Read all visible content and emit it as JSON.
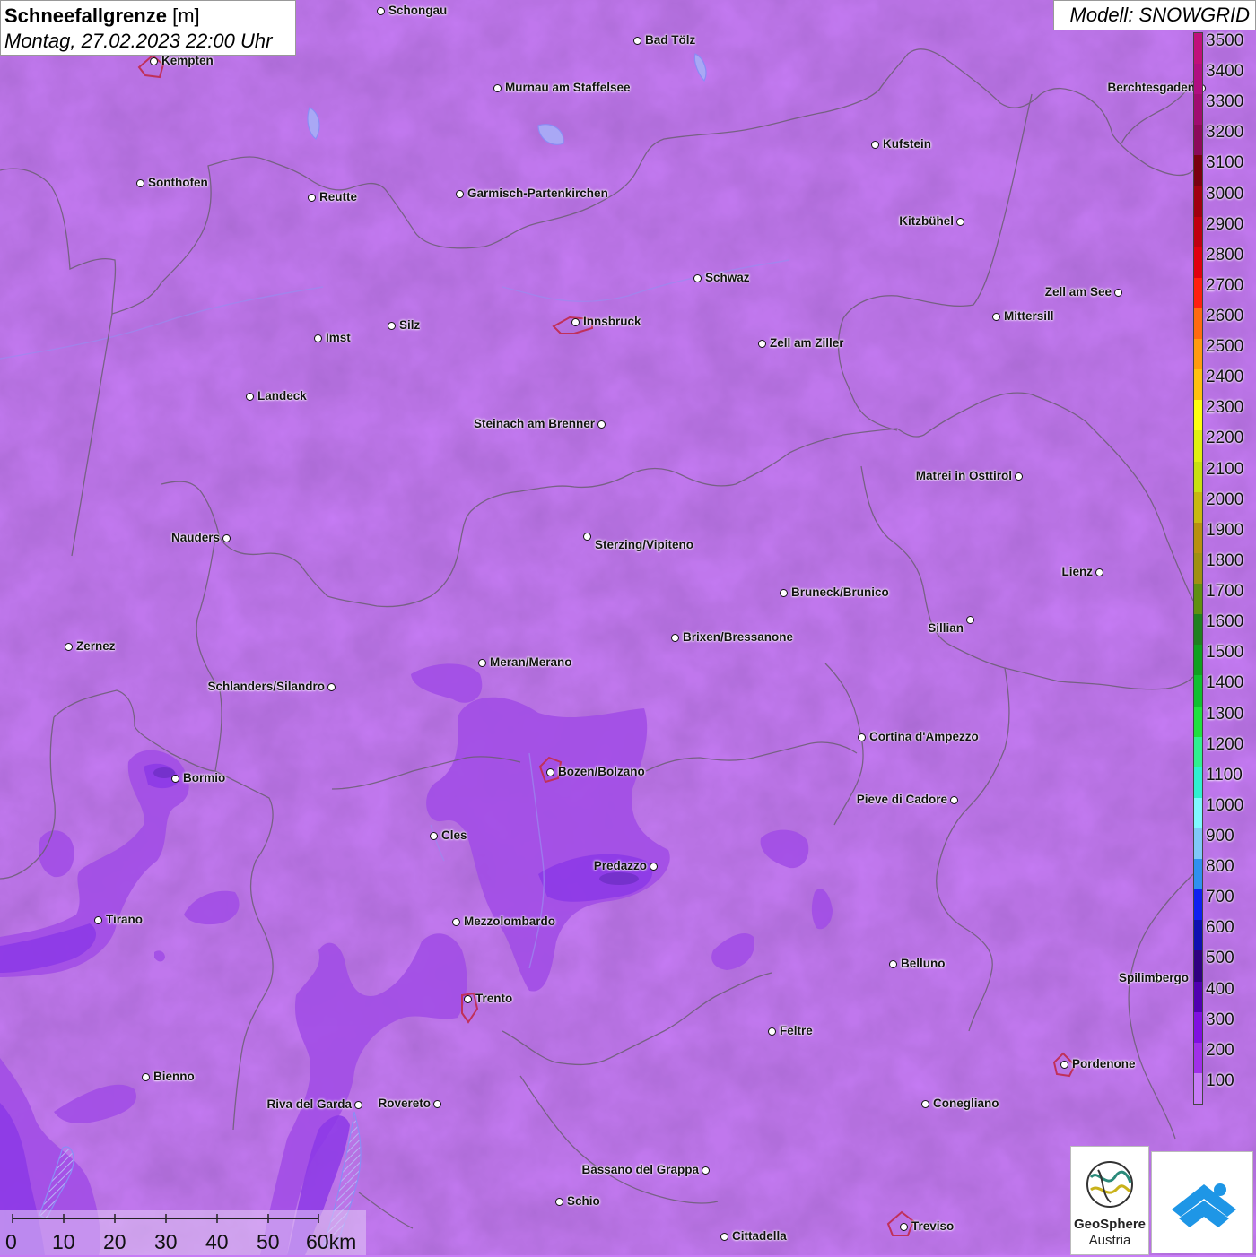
{
  "title": {
    "parameter": "Schneefallgrenze",
    "unit": "[m]",
    "datetime": "Montag, 27.02.2023 22:00 Uhr"
  },
  "model": "Modell: SNOWGRID",
  "colors": {
    "base_field": "#c77cf6",
    "field_200": "#a24ee6",
    "field_300": "#8c38e6",
    "field_400": "#7a2fd6",
    "borders": "#6b5e73",
    "lakes": "#8a8cf5",
    "city_outline": "#c0305a"
  },
  "cities": [
    {
      "name": "Schongau"
    },
    {
      "name": "Kempten"
    },
    {
      "name": "Bad Tölz"
    },
    {
      "name": "Murnau am Staffelsee"
    },
    {
      "name": "Berchtesgaden"
    },
    {
      "name": "Kufstein"
    },
    {
      "name": "Sonthofen"
    },
    {
      "name": "Reutte"
    },
    {
      "name": "Garmisch-Partenkirchen"
    },
    {
      "name": "Kitzbühel"
    },
    {
      "name": "Schwaz"
    },
    {
      "name": "Zell am See"
    },
    {
      "name": "Innsbruck"
    },
    {
      "name": "Mittersill"
    },
    {
      "name": "Imst"
    },
    {
      "name": "Silz"
    },
    {
      "name": "Zell am Ziller"
    },
    {
      "name": "Landeck"
    },
    {
      "name": "Steinach am Brenner"
    },
    {
      "name": "Matrei in Osttirol"
    },
    {
      "name": "Nauders"
    },
    {
      "name": "Sterzing/Vipiteno"
    },
    {
      "name": "Lienz"
    },
    {
      "name": "Bruneck/Brunico"
    },
    {
      "name": "Sillian"
    },
    {
      "name": "Zernez"
    },
    {
      "name": "Brixen/Bressanone"
    },
    {
      "name": "Meran/Merano"
    },
    {
      "name": "Schlanders/Silandro"
    },
    {
      "name": "Cortina d'Ampezzo"
    },
    {
      "name": "Bozen/Bolzano"
    },
    {
      "name": "Bormio"
    },
    {
      "name": "Pieve di Cadore"
    },
    {
      "name": "Cles"
    },
    {
      "name": "Predazzo"
    },
    {
      "name": "Tirano"
    },
    {
      "name": "Mezzolombardo"
    },
    {
      "name": "Belluno"
    },
    {
      "name": "Spilimbergo"
    },
    {
      "name": "Trento"
    },
    {
      "name": "Feltre"
    },
    {
      "name": "Pordenone"
    },
    {
      "name": "Bienno"
    },
    {
      "name": "Riva del Garda"
    },
    {
      "name": "Rovereto"
    },
    {
      "name": "Conegliano"
    },
    {
      "name": "Bassano del Grappa"
    },
    {
      "name": "Schio"
    },
    {
      "name": "Treviso"
    },
    {
      "name": "Cittadella"
    }
  ],
  "legend": {
    "levels": [
      {
        "value": "3500",
        "color": "#c0107a"
      },
      {
        "value": "3400",
        "color": "#b00e80"
      },
      {
        "value": "3300",
        "color": "#a00c70"
      },
      {
        "value": "3200",
        "color": "#8c0a5a"
      },
      {
        "value": "3100",
        "color": "#7a0010"
      },
      {
        "value": "3000",
        "color": "#a00010"
      },
      {
        "value": "2900",
        "color": "#c00010"
      },
      {
        "value": "2800",
        "color": "#e00010"
      },
      {
        "value": "2700",
        "color": "#ff2010"
      },
      {
        "value": "2600",
        "color": "#ff6a10"
      },
      {
        "value": "2500",
        "color": "#ff9a10"
      },
      {
        "value": "2400",
        "color": "#ffc010"
      },
      {
        "value": "2300",
        "color": "#ffff10"
      },
      {
        "value": "2200",
        "color": "#e0f010"
      },
      {
        "value": "2100",
        "color": "#c8e010"
      },
      {
        "value": "2000",
        "color": "#c8b810"
      },
      {
        "value": "1900",
        "color": "#b89010"
      },
      {
        "value": "1800",
        "color": "#a09010"
      },
      {
        "value": "1700",
        "color": "#609010"
      },
      {
        "value": "1600",
        "color": "#208020"
      },
      {
        "value": "1500",
        "color": "#10a020"
      },
      {
        "value": "1400",
        "color": "#10c030"
      },
      {
        "value": "1300",
        "color": "#20e040"
      },
      {
        "value": "1200",
        "color": "#30f090"
      },
      {
        "value": "1100",
        "color": "#30f0d0"
      },
      {
        "value": "1000",
        "color": "#80f8ff"
      },
      {
        "value": "900",
        "color": "#80c8f8"
      },
      {
        "value": "800",
        "color": "#3090f0"
      },
      {
        "value": "700",
        "color": "#1020f0"
      },
      {
        "value": "600",
        "color": "#1010b0"
      },
      {
        "value": "500",
        "color": "#300080"
      },
      {
        "value": "400",
        "color": "#5000b0"
      },
      {
        "value": "300",
        "color": "#8010e0"
      },
      {
        "value": "200",
        "color": "#a030e8"
      },
      {
        "value": "100",
        "color": "#c77cf6"
      }
    ]
  },
  "scalebar": {
    "ticks": [
      "0",
      "10",
      "20",
      "30",
      "40",
      "50",
      "60km"
    ]
  },
  "logos": {
    "geosphere_line1": "GeoSphere",
    "geosphere_line2": "Austria",
    "app_icon": "snowflake-mountain-icon"
  }
}
